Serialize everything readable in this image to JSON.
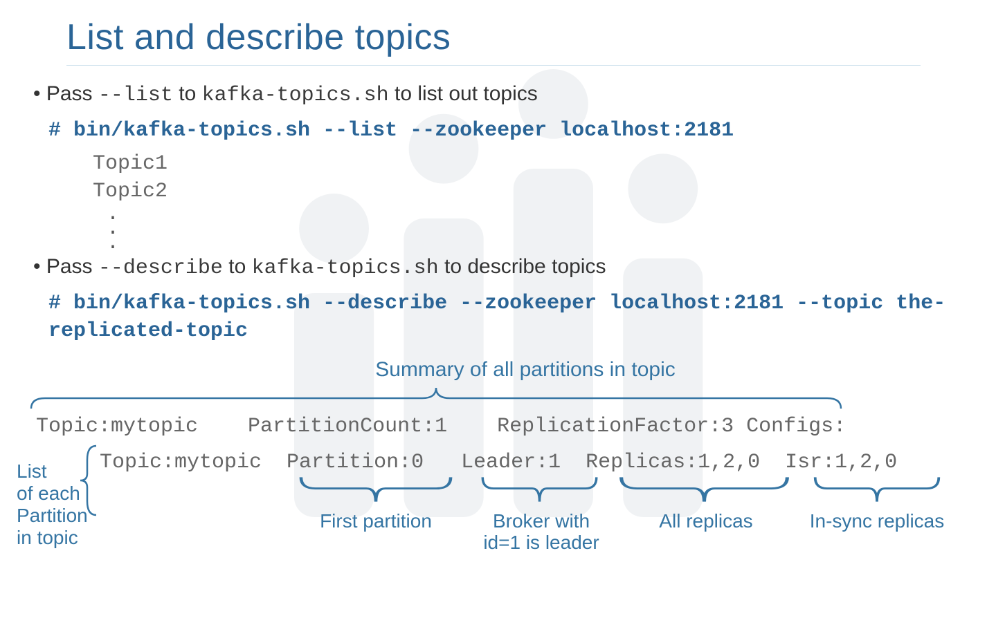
{
  "title": "List and describe topics",
  "bullets": {
    "list_prefix": "Pass ",
    "list_flag": "--list",
    "list_mid": " to ",
    "list_cmd": "kafka-topics.sh",
    "list_suffix": " to list out topics",
    "describe_prefix": "Pass ",
    "describe_flag": "--describe",
    "describe_mid": " to ",
    "describe_cmd": "kafka-topics.sh",
    "describe_suffix": " to describe topics"
  },
  "commands": {
    "list": "# bin/kafka-topics.sh --list --zookeeper localhost:2181",
    "describe": "# bin/kafka-topics.sh --describe --zookeeper localhost:2181 --topic the-replicated-topic"
  },
  "list_output": [
    "Topic1",
    "Topic2"
  ],
  "summary_label": "Summary of all partitions in topic",
  "describe_output": {
    "row1": "Topic:mytopic    PartitionCount:1    ReplicationFactor:3 Configs:",
    "row2": "Topic:mytopic  Partition:0   Leader:1  Replicas:1,2,0  Isr:1,2,0"
  },
  "annotations": {
    "left": "List\nof each\nPartition\nin topic",
    "partition": "First partition",
    "leader": "Broker with\nid=1 is leader",
    "replicas": "All replicas",
    "isr": "In-sync replicas"
  }
}
